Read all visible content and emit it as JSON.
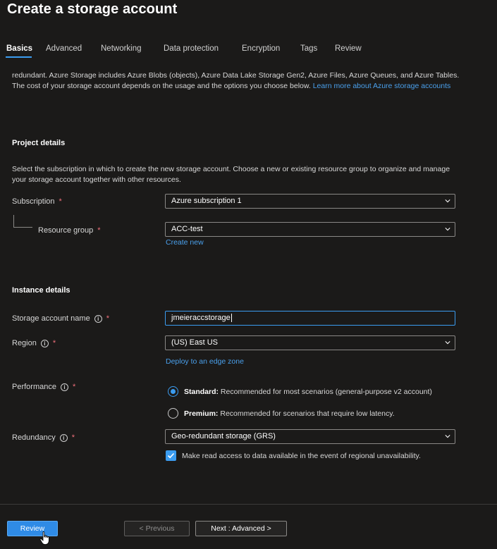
{
  "page": {
    "title": "Create a storage account"
  },
  "tabs": [
    {
      "label": "Basics"
    },
    {
      "label": "Advanced"
    },
    {
      "label": "Networking"
    },
    {
      "label": "Data protection"
    },
    {
      "label": "Encryption"
    },
    {
      "label": "Tags"
    },
    {
      "label": "Review"
    }
  ],
  "intro": {
    "text": "redundant. Azure Storage includes Azure Blobs (objects), Azure Data Lake Storage Gen2, Azure Files, Azure Queues, and Azure Tables. The cost of your storage account depends on the usage and the options you choose below. ",
    "link": "Learn more about Azure storage accounts"
  },
  "project": {
    "title": "Project details",
    "description": "Select the subscription in which to create the new storage account. Choose a new or existing resource group to organize and manage your storage account together with other resources.",
    "subscription_label": "Subscription",
    "subscription_value": "Azure subscription 1",
    "resource_group_label": "Resource group",
    "resource_group_value": "ACC-test",
    "create_new": "Create new"
  },
  "instance": {
    "title": "Instance details",
    "name_label": "Storage account name",
    "name_value": "jmeieraccstorage",
    "region_label": "Region",
    "region_value": "(US) East US",
    "edge_zone_link": "Deploy to an edge zone",
    "performance_label": "Performance",
    "standard_label": "Standard:",
    "standard_desc": " Recommended for most scenarios (general-purpose v2 account)",
    "premium_label": "Premium:",
    "premium_desc": " Recommended for scenarios that require low latency.",
    "redundancy_label": "Redundancy",
    "redundancy_value": "Geo-redundant storage (GRS)",
    "read_access_label": "Make read access to data available in the event of regional unavailability."
  },
  "required_mark": "*",
  "footer": {
    "review": "Review",
    "previous": "< Previous",
    "next": "Next : Advanced >"
  },
  "colors": {
    "accent": "#3b9cf0",
    "background": "#1b1a19"
  }
}
